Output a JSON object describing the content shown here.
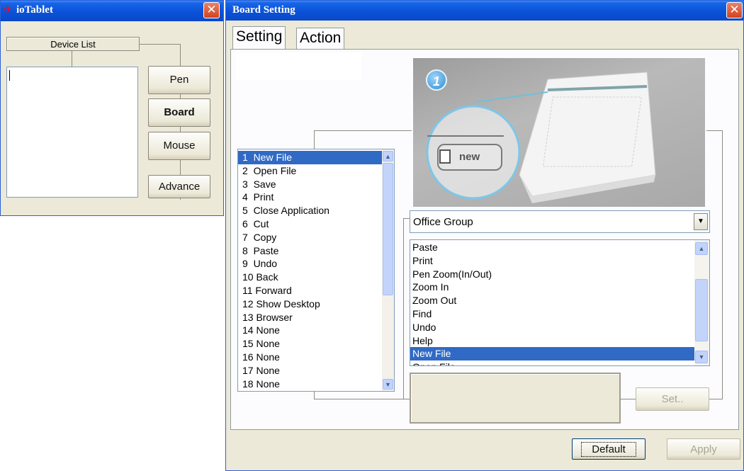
{
  "io_window": {
    "title": "ioTablet",
    "device_list_label": "Device List",
    "buttons": {
      "pen": "Pen",
      "board": "Board",
      "mouse": "Mouse",
      "advance": "Advance"
    }
  },
  "board_window": {
    "title": "Board Setting",
    "tabs": [
      "Setting",
      "Action"
    ],
    "image_badge": "1",
    "image_key_label": "new",
    "key_list": [
      "1  New File",
      "2  Open File",
      "3  Save",
      "4  Print",
      "5  Close Application",
      "6  Cut",
      "7  Copy",
      "8  Paste",
      "9  Undo",
      "10 Back",
      "11 Forward",
      "12 Show Desktop",
      "13 Browser",
      "14 None",
      "15 None",
      "16 None",
      "17 None",
      "18 None"
    ],
    "key_list_selected": 0,
    "group_select": "Office Group",
    "command_list": [
      "Paste",
      "Print",
      "Pen Zoom(In/Out)",
      "Zoom In",
      "Zoom Out",
      "Find",
      "Undo",
      "Help",
      "New File",
      "Open File"
    ],
    "command_list_selected": 8,
    "set_button": "Set..",
    "default_button": "Default",
    "apply_button": "Apply"
  }
}
